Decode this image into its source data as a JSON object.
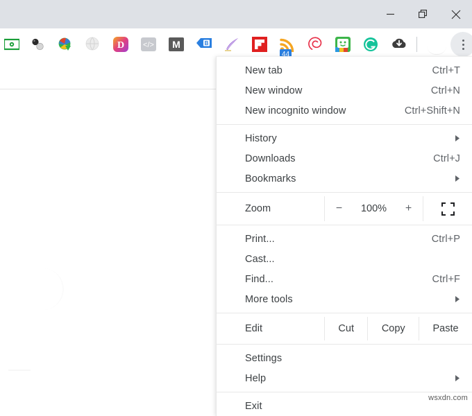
{
  "window": {
    "controls": [
      {
        "name": "minimize",
        "glyph": "minimize-icon"
      },
      {
        "name": "restore",
        "glyph": "restore-icon"
      },
      {
        "name": "close",
        "glyph": "close-icon"
      }
    ]
  },
  "toolbar": {
    "extensions": [
      {
        "name": "cash-extension-icon",
        "badge": ""
      },
      {
        "name": "molecule-extension-icon",
        "badge": ""
      },
      {
        "name": "internet-download-manager-icon",
        "badge": ""
      },
      {
        "name": "gray-sphere-extension-icon",
        "badge": ""
      },
      {
        "name": "letter-d-extension-icon",
        "badge": ""
      },
      {
        "name": "code-tags-extension-icon",
        "badge": ""
      },
      {
        "name": "letter-m-extension-icon",
        "badge": ""
      },
      {
        "name": "blue-tag-extension-icon",
        "badge": ""
      },
      {
        "name": "purple-quill-extension-icon",
        "badge": ""
      },
      {
        "name": "flipboard-extension-icon",
        "badge": ""
      },
      {
        "name": "rss-feed-extension-icon",
        "badge": "44"
      },
      {
        "name": "spiral-extension-icon",
        "badge": ""
      },
      {
        "name": "smiley-square-extension-icon",
        "badge": ""
      },
      {
        "name": "grammarly-extension-icon",
        "badge": ""
      },
      {
        "name": "download-cloud-extension-icon",
        "badge": ""
      }
    ],
    "menu_button": "chrome-menu-button"
  },
  "menu": {
    "groups": [
      {
        "type": "items",
        "items": [
          {
            "label": "New tab",
            "accel": "Ctrl+T",
            "submenu": false
          },
          {
            "label": "New window",
            "accel": "Ctrl+N",
            "submenu": false
          },
          {
            "label": "New incognito window",
            "accel": "Ctrl+Shift+N",
            "submenu": false
          }
        ]
      },
      {
        "type": "items",
        "items": [
          {
            "label": "History",
            "accel": "",
            "submenu": true
          },
          {
            "label": "Downloads",
            "accel": "Ctrl+J",
            "submenu": false
          },
          {
            "label": "Bookmarks",
            "accel": "",
            "submenu": true
          }
        ]
      },
      {
        "type": "zoom",
        "label": "Zoom",
        "minus": "−",
        "value": "100%",
        "plus": "+",
        "fullscreen": "fullscreen-icon"
      },
      {
        "type": "items",
        "items": [
          {
            "label": "Print...",
            "accel": "Ctrl+P",
            "submenu": false
          },
          {
            "label": "Cast...",
            "accel": "",
            "submenu": false
          },
          {
            "label": "Find...",
            "accel": "Ctrl+F",
            "submenu": false
          },
          {
            "label": "More tools",
            "accel": "",
            "submenu": true
          }
        ]
      },
      {
        "type": "edit",
        "label": "Edit",
        "actions": [
          "Cut",
          "Copy",
          "Paste"
        ]
      },
      {
        "type": "items",
        "items": [
          {
            "label": "Settings",
            "accel": "",
            "submenu": false
          },
          {
            "label": "Help",
            "accel": "",
            "submenu": true
          }
        ]
      },
      {
        "type": "items",
        "items": [
          {
            "label": "Exit",
            "accel": "",
            "submenu": false
          }
        ]
      }
    ]
  },
  "watermark": "wsxdn.com",
  "colors": {
    "titlebar": "#dee1e6",
    "menu_button_bg": "#e8eaed",
    "badge": "#2a7fe0",
    "text": "#3c4043",
    "accel": "#5f6368"
  }
}
